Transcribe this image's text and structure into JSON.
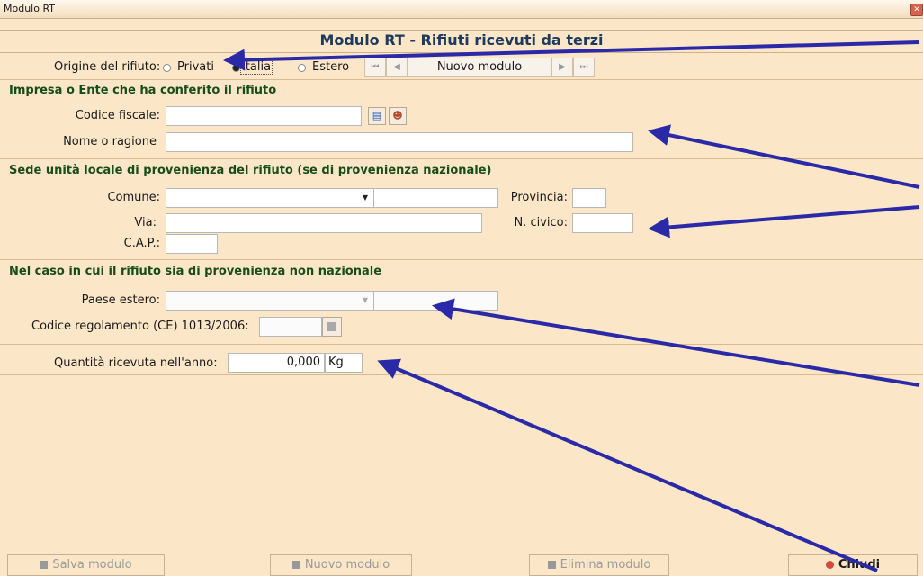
{
  "window": {
    "title": "Modulo RT",
    "close_icon": "close-icon"
  },
  "header": {
    "title": "Modulo RT - Rifiuti ricevuti da terzi"
  },
  "origin": {
    "label": "Origine del rifiuto:",
    "options": [
      "Privati",
      "Italia",
      "Estero"
    ],
    "selected": "Italia"
  },
  "nav": {
    "first": "⏮",
    "prev": "◀",
    "label": "Nuovo modulo",
    "next": "▶",
    "last": "⏭"
  },
  "section1": {
    "title": "Impresa o Ente che ha conferito il rifiuto",
    "cf_label": "Codice fiscale:",
    "cf_value": "",
    "name_label": "Nome o ragione",
    "name_value": ""
  },
  "section2": {
    "title": "Sede unità locale di provenienza del rifiuto (se di provenienza nazionale)",
    "comune_label": "Comune:",
    "comune_value": "",
    "provincia_label": "Provincia:",
    "provincia_value": "",
    "via_label": "Via:",
    "via_value": "",
    "civico_label": "N. civico:",
    "civico_value": "",
    "cap_label": "C.A.P.:",
    "cap_value": ""
  },
  "section3": {
    "title": "Nel caso in cui il rifiuto sia di provenienza non nazionale",
    "paese_label": "Paese estero:",
    "paese_value": "",
    "codice_label": "Codice regolamento (CE) 1013/2006:",
    "codice_value": ""
  },
  "quantity": {
    "label": "Quantità ricevuta nell'anno:",
    "value": "0,000",
    "unit": "Kg"
  },
  "footer": {
    "save": "Salva modulo",
    "new": "Nuovo modulo",
    "delete": "Elimina modulo",
    "close": "Chiudi"
  },
  "colors": {
    "background": "#fbe6c8",
    "accent": "#1e3a5c",
    "section": "#184d18",
    "annotation_arrows": "#2a2aa8"
  }
}
